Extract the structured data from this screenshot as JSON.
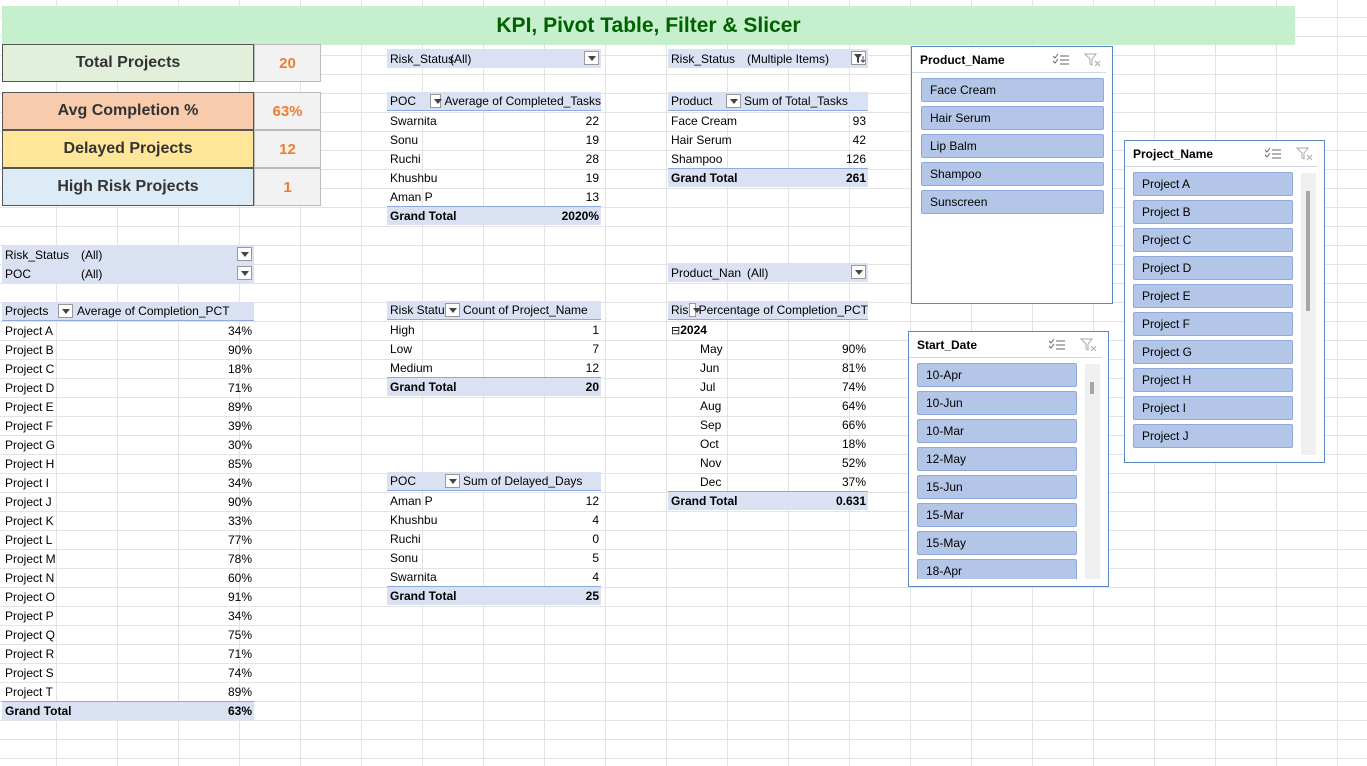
{
  "title": "KPI, Pivot Table, Filter & Slicer",
  "kpis": [
    {
      "label": "Total Projects",
      "value": "20",
      "bg": "#e2efda"
    },
    {
      "label": "Avg Completion %",
      "value": "63%",
      "bg": "#f8cbad"
    },
    {
      "label": "Delayed Projects",
      "value": "12",
      "bg": "#ffe699"
    },
    {
      "label": "High Risk Projects",
      "value": "1",
      "bg": "#ddebf7"
    }
  ],
  "pivot_completion": {
    "filters": [
      {
        "name": "Risk_Status",
        "value": "(All)"
      },
      {
        "name": "POC",
        "value": "(All)"
      }
    ],
    "headers": [
      "Projects",
      "Average of Completion_PCT"
    ],
    "rows": [
      [
        "Project A",
        "34%"
      ],
      [
        "Project B",
        "90%"
      ],
      [
        "Project C",
        "18%"
      ],
      [
        "Project D",
        "71%"
      ],
      [
        "Project E",
        "89%"
      ],
      [
        "Project F",
        "39%"
      ],
      [
        "Project G",
        "30%"
      ],
      [
        "Project H",
        "85%"
      ],
      [
        "Project I",
        "34%"
      ],
      [
        "Project J",
        "90%"
      ],
      [
        "Project K",
        "33%"
      ],
      [
        "Project L",
        "77%"
      ],
      [
        "Project M",
        "78%"
      ],
      [
        "Project N",
        "60%"
      ],
      [
        "Project O",
        "91%"
      ],
      [
        "Project P",
        "34%"
      ],
      [
        "Project Q",
        "75%"
      ],
      [
        "Project R",
        "71%"
      ],
      [
        "Project S",
        "74%"
      ],
      [
        "Project T",
        "89%"
      ]
    ],
    "total": [
      "Grand Total",
      "63%"
    ]
  },
  "pivot_tasks_poc": {
    "filter": {
      "name": "Risk_Status",
      "value": "(All)"
    },
    "headers": [
      "POC",
      "Average of Completed_Tasks"
    ],
    "rows": [
      [
        "Swarnita",
        "22"
      ],
      [
        "Sonu",
        "19"
      ],
      [
        "Ruchi",
        "28"
      ],
      [
        "Khushbu",
        "19"
      ],
      [
        "Aman P",
        "13"
      ]
    ],
    "total": [
      "Grand Total",
      "2020%"
    ]
  },
  "pivot_risk_count": {
    "headers": [
      "Risk Statu",
      "Count of Project_Name"
    ],
    "rows": [
      [
        "High",
        "1"
      ],
      [
        "Low",
        "7"
      ],
      [
        "Medium",
        "12"
      ]
    ],
    "total": [
      "Grand Total",
      "20"
    ]
  },
  "pivot_delayed": {
    "headers": [
      "POC",
      "Sum of Delayed_Days"
    ],
    "rows": [
      [
        "Aman P",
        "12"
      ],
      [
        "Khushbu",
        "4"
      ],
      [
        "Ruchi",
        "0"
      ],
      [
        "Sonu",
        "5"
      ],
      [
        "Swarnita",
        "4"
      ]
    ],
    "total": [
      "Grand Total",
      "25"
    ]
  },
  "pivot_product_tasks": {
    "filter": {
      "name": "Risk_Status",
      "value": "(Multiple Items)"
    },
    "headers": [
      "Product",
      "Sum of Total_Tasks"
    ],
    "rows": [
      [
        "Face Cream",
        "93"
      ],
      [
        "Hair Serum",
        "42"
      ],
      [
        "Shampoo",
        "126"
      ]
    ],
    "total": [
      "Grand Total",
      "261"
    ]
  },
  "pivot_monthly": {
    "filter": {
      "name": "Product_Nan",
      "value": "(All)"
    },
    "headers": [
      "Risk Statu",
      "Percentage of Completion_PCT"
    ],
    "year": "2024",
    "collapse_glyph": "⊟",
    "rows": [
      [
        "May",
        "90%"
      ],
      [
        "Jun",
        "81%"
      ],
      [
        "Jul",
        "74%"
      ],
      [
        "Aug",
        "64%"
      ],
      [
        "Sep",
        "66%"
      ],
      [
        "Oct",
        "18%"
      ],
      [
        "Nov",
        "52%"
      ],
      [
        "Dec",
        "37%"
      ]
    ],
    "total": [
      "Grand Total",
      "0.631"
    ]
  },
  "slicer_product": {
    "title": "Product_Name",
    "items": [
      "Face Cream",
      "Hair Serum",
      "Lip Balm",
      "Shampoo",
      "Sunscreen"
    ]
  },
  "slicer_project": {
    "title": "Project_Name",
    "items": [
      "Project A",
      "Project B",
      "Project C",
      "Project D",
      "Project E",
      "Project F",
      "Project G",
      "Project H",
      "Project I",
      "Project J"
    ]
  },
  "slicer_date": {
    "title": "Start_Date",
    "items": [
      "10-Apr",
      "10-Jun",
      "10-Mar",
      "12-May",
      "15-Jun",
      "15-Mar",
      "15-May",
      "18-Apr"
    ]
  },
  "colors": {
    "title_bg": "#c6efce",
    "title_fg": "#006100",
    "kpi_value": "#ed7d31",
    "pivot_header": "#d9e1f2",
    "slicer_item": "#b4c6e7"
  }
}
